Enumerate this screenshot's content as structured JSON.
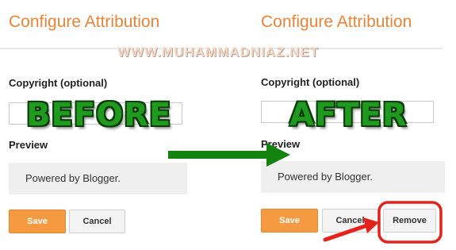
{
  "watermark": "WWW.MUHAMMADNIAZ.NET",
  "before": {
    "title": "Configure Attribution",
    "copyright_label": "Copyright (optional)",
    "copyright_value": "",
    "overlay_word": "BEFORE",
    "preview_label": "Preview",
    "preview_text": "Powered by Blogger.",
    "save_label": "Save",
    "cancel_label": "Cancel"
  },
  "after": {
    "title": "Configure Attribution",
    "copyright_label": "Copyright (optional)",
    "copyright_value": "",
    "overlay_word": "AFTER",
    "preview_label": "Preview",
    "preview_text": "Powered by Blogger.",
    "save_label": "Save",
    "cancel_label": "Cancel",
    "remove_label": "Remove"
  },
  "colors": {
    "title": "#e8843a",
    "save_button": "#f59a40",
    "overlay_text": "#1f9a1f",
    "transition_arrow": "#14820f",
    "highlight": "#e3221c"
  },
  "icons": {
    "transition_arrow": "green-right-arrow",
    "pointer_arrow": "red-pointer-arrow",
    "highlight": "red-rounded-outline"
  }
}
